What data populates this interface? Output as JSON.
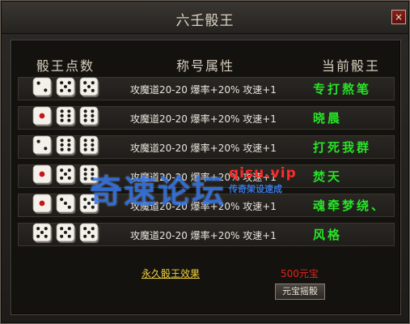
{
  "window": {
    "title": "六壬骰王",
    "close_label": "×"
  },
  "headers": {
    "dice": "骰王点数",
    "attribute": "称号属性",
    "king": "当前骰王"
  },
  "rows": [
    {
      "dice": [
        2,
        5,
        5
      ],
      "attribute": "攻魔道20-20 爆率+20% 攻速+1",
      "king": "专打熬笔"
    },
    {
      "dice": [
        1,
        6,
        6
      ],
      "attribute": "攻魔道20-20 爆率+20% 攻速+1",
      "king": "晓晨"
    },
    {
      "dice": [
        2,
        6,
        6
      ],
      "attribute": "攻魔道20-20 爆率+20% 攻速+1",
      "king": "打死我群"
    },
    {
      "dice": [
        1,
        5,
        6
      ],
      "attribute": "攻魔道20-20 爆率+20% 攻速+1",
      "king": "焚天"
    },
    {
      "dice": [
        1,
        3,
        5
      ],
      "attribute": "攻魔道20-20 爆率+20% 攻速+1",
      "king": "魂牵梦绕、"
    },
    {
      "dice": [
        5,
        5,
        5
      ],
      "attribute": "攻魔道20-20 爆率+20% 攻速+1",
      "king": "风格"
    }
  ],
  "footer": {
    "permanent_effect": "永久骰王效果",
    "price": "500元宝",
    "roll_button": "元宝摇骰"
  },
  "watermark": {
    "main": "奇速论坛",
    "url": "qisu.vip",
    "sub": "传奇架设速成"
  },
  "colors": {
    "king_name": "#27e327",
    "link": "#f0d23a",
    "price": "#e0241c",
    "pip_red": "#c8141a"
  }
}
